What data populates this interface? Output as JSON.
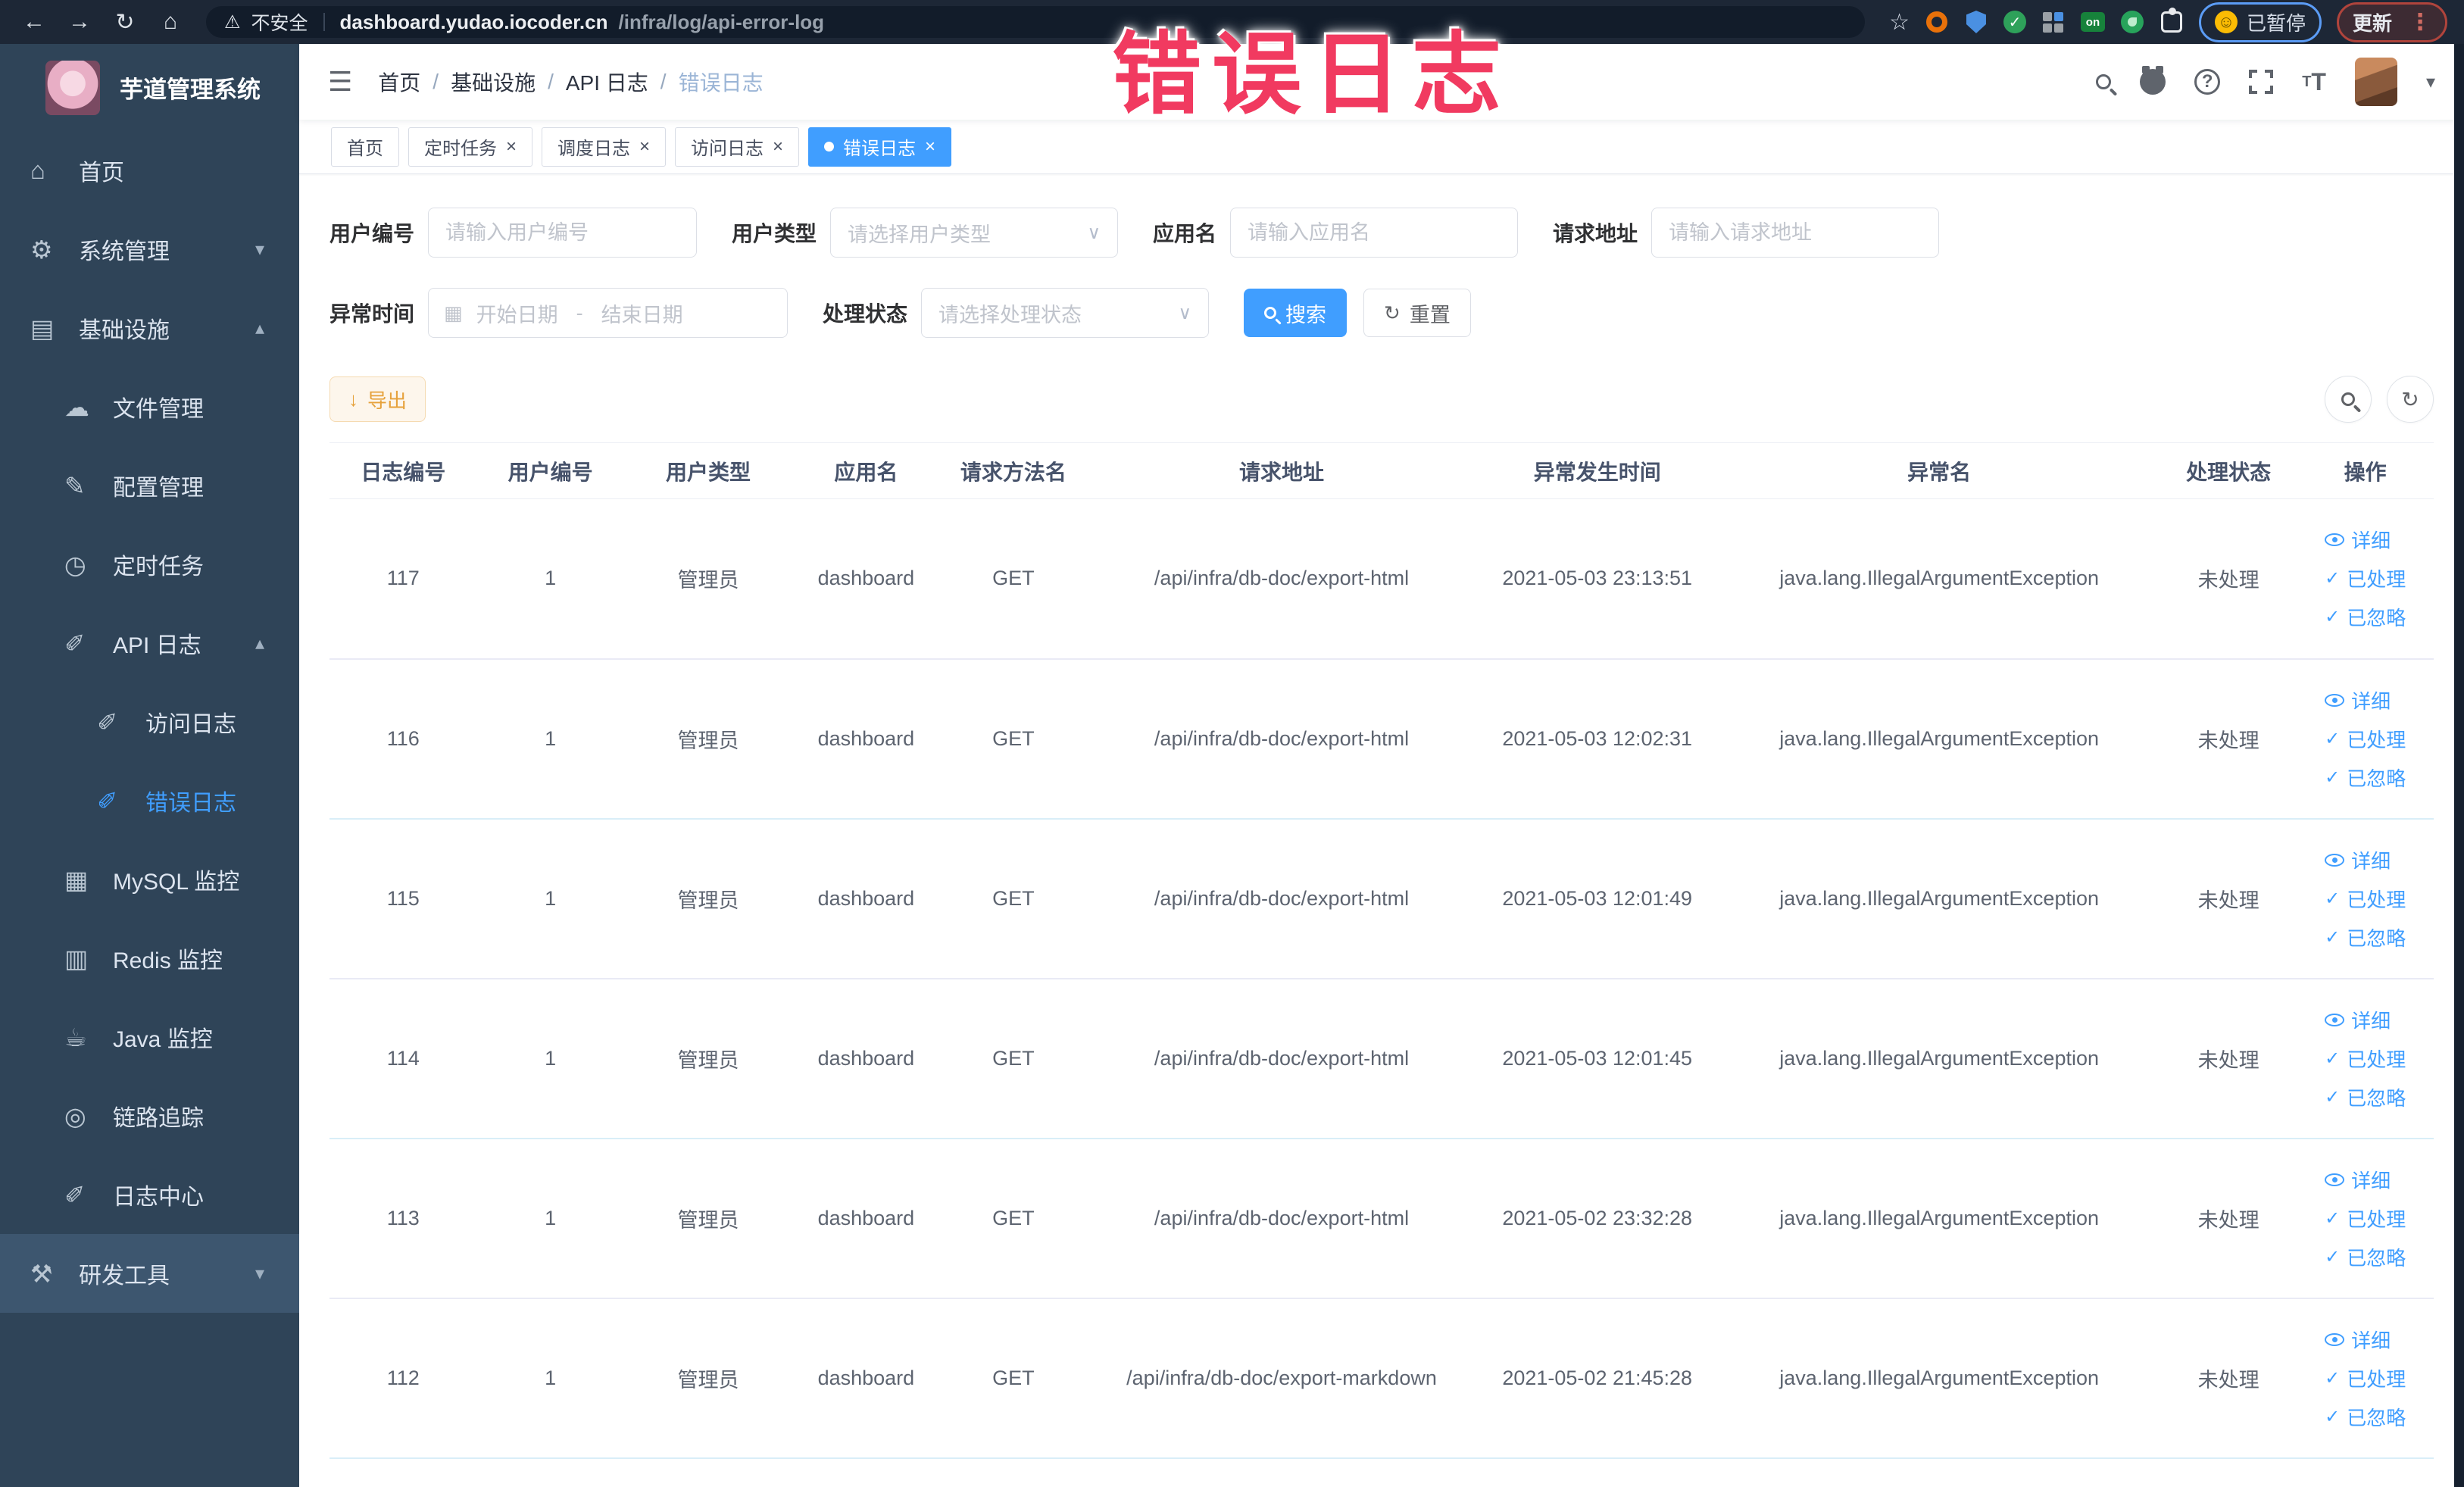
{
  "browser": {
    "security": "不安全",
    "url_host": "dashboard.yudao.iocoder.cn",
    "url_path": "/infra/log/api-error-log",
    "ext_on": "on",
    "paused_label": "已暂停",
    "update_label": "更新"
  },
  "overlay": {
    "text": "错误日志"
  },
  "sidebar": {
    "title": "芋道管理系统",
    "items": [
      {
        "label": "首页"
      },
      {
        "label": "系统管理"
      },
      {
        "label": "基础设施"
      },
      {
        "label": "文件管理"
      },
      {
        "label": "配置管理"
      },
      {
        "label": "定时任务"
      },
      {
        "label": "API 日志"
      },
      {
        "label": "访问日志"
      },
      {
        "label": "错误日志"
      },
      {
        "label": "MySQL 监控"
      },
      {
        "label": "Redis 监控"
      },
      {
        "label": "Java 监控"
      },
      {
        "label": "链路追踪"
      },
      {
        "label": "日志中心"
      },
      {
        "label": "研发工具"
      }
    ]
  },
  "header": {
    "breadcrumb": [
      "首页",
      "基础设施",
      "API 日志",
      "错误日志"
    ],
    "separator": "/"
  },
  "tabs": {
    "close": "×",
    "items": [
      {
        "label": "首页"
      },
      {
        "label": "定时任务"
      },
      {
        "label": "调度日志"
      },
      {
        "label": "访问日志"
      },
      {
        "label": "错误日志"
      }
    ]
  },
  "filters": {
    "user_id": {
      "label": "用户编号",
      "placeholder": "请输入用户编号"
    },
    "user_type": {
      "label": "用户类型",
      "placeholder": "请选择用户类型"
    },
    "app_name": {
      "label": "应用名",
      "placeholder": "请输入应用名"
    },
    "request_url": {
      "label": "请求地址",
      "placeholder": "请输入请求地址"
    },
    "exception_time": {
      "label": "异常时间",
      "start_placeholder": "开始日期",
      "separator": "-",
      "end_placeholder": "结束日期"
    },
    "process_status": {
      "label": "处理状态",
      "placeholder": "请选择处理状态"
    },
    "search": "搜索",
    "reset": "重置"
  },
  "toolbar": {
    "export": "导出"
  },
  "table": {
    "headers": [
      "日志编号",
      "用户编号",
      "用户类型",
      "应用名",
      "请求方法名",
      "请求地址",
      "异常发生时间",
      "异常名",
      "处理状态",
      "操作"
    ],
    "actions": {
      "detail": "详细",
      "processed": "已处理",
      "ignored": "已忽略"
    },
    "rows": [
      {
        "id": "117",
        "user_id": "1",
        "user_type": "管理员",
        "app": "dashboard",
        "method": "GET",
        "url": "/api/infra/db-doc/export-html",
        "time": "2021-05-03 23:13:51",
        "exception": "java.lang.IllegalArgumentException",
        "status": "未处理"
      },
      {
        "id": "116",
        "user_id": "1",
        "user_type": "管理员",
        "app": "dashboard",
        "method": "GET",
        "url": "/api/infra/db-doc/export-html",
        "time": "2021-05-03 12:02:31",
        "exception": "java.lang.IllegalArgumentException",
        "status": "未处理"
      },
      {
        "id": "115",
        "user_id": "1",
        "user_type": "管理员",
        "app": "dashboard",
        "method": "GET",
        "url": "/api/infra/db-doc/export-html",
        "time": "2021-05-03 12:01:49",
        "exception": "java.lang.IllegalArgumentException",
        "status": "未处理"
      },
      {
        "id": "114",
        "user_id": "1",
        "user_type": "管理员",
        "app": "dashboard",
        "method": "GET",
        "url": "/api/infra/db-doc/export-html",
        "time": "2021-05-03 12:01:45",
        "exception": "java.lang.IllegalArgumentException",
        "status": "未处理"
      },
      {
        "id": "113",
        "user_id": "1",
        "user_type": "管理员",
        "app": "dashboard",
        "method": "GET",
        "url": "/api/infra/db-doc/export-html",
        "time": "2021-05-02 23:32:28",
        "exception": "java.lang.IllegalArgumentException",
        "status": "未处理"
      },
      {
        "id": "112",
        "user_id": "1",
        "user_type": "管理员",
        "app": "dashboard",
        "method": "GET",
        "url": "/api/infra/db-doc/export-markdown",
        "time": "2021-05-02 21:45:28",
        "exception": "java.lang.IllegalArgumentException",
        "status": "未处理"
      }
    ]
  },
  "icons": {
    "back": "←",
    "forward": "→",
    "reload": "↻",
    "home": "⌂",
    "warning": "⚠",
    "star": "☆",
    "kebab": "⋮",
    "smiley": "☺",
    "hamburger": "☰",
    "caret-down": "▾",
    "chevron-down": "▾",
    "chevron-up": "▴",
    "select-arrow": "∨",
    "calendar": "▦",
    "download": "↓",
    "refresh": "↻",
    "check": "✓",
    "question": "?",
    "font-big": "T",
    "font-small": "T",
    "menu-home": "⌂",
    "menu-gear": "⚙",
    "menu-monitor": "▤",
    "menu-cloud": "☁",
    "menu-edit": "✎",
    "menu-clock": "◷",
    "menu-doc": "✐",
    "menu-db": "▦",
    "menu-layers": "▥",
    "menu-java": "☕",
    "menu-eye": "◎",
    "menu-log": "✐",
    "menu-tools": "⚒"
  }
}
